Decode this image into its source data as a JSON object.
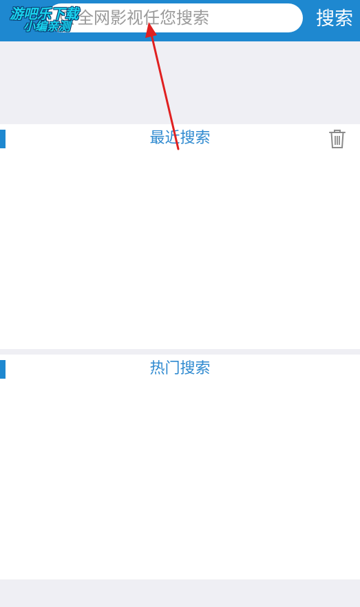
{
  "header": {
    "search_placeholder": "全网影视任您搜索",
    "search_button_label": "搜索"
  },
  "watermark": {
    "line1": "游吧乐下载",
    "line2": "小编亲测"
  },
  "sections": {
    "recent": {
      "title": "最近搜索",
      "delete_icon": "trash-icon"
    },
    "hot": {
      "title": "热门搜索"
    }
  },
  "colors": {
    "brand_blue": "#1e88d0",
    "title_blue": "#2f8ad0",
    "background": "#efeff4",
    "annotation_red": "#e02020"
  }
}
